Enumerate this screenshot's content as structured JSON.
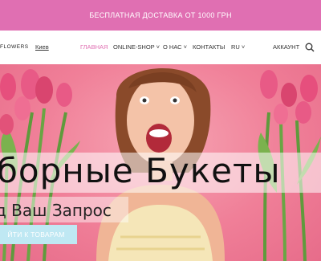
{
  "promo": {
    "text": "БЕСПЛАТНАЯ ДОСТАВКА ОТ 1000 ГРН"
  },
  "nav": {
    "logo": "FLOWERS",
    "city": "Киев",
    "items": [
      {
        "label": "ГЛАВНАЯ"
      },
      {
        "label": "ONLINE-SHOP"
      },
      {
        "label": "О НАС"
      },
      {
        "label": "КОНТАКТЫ"
      },
      {
        "label": "RU"
      }
    ],
    "account": "АККАУНТ",
    "accent_color": "#e06fb2"
  },
  "hero": {
    "headline": "борные Букеты",
    "subheadline": "д Ваш Запрос",
    "cta": "ЙТИ К ТОВАРАМ"
  }
}
